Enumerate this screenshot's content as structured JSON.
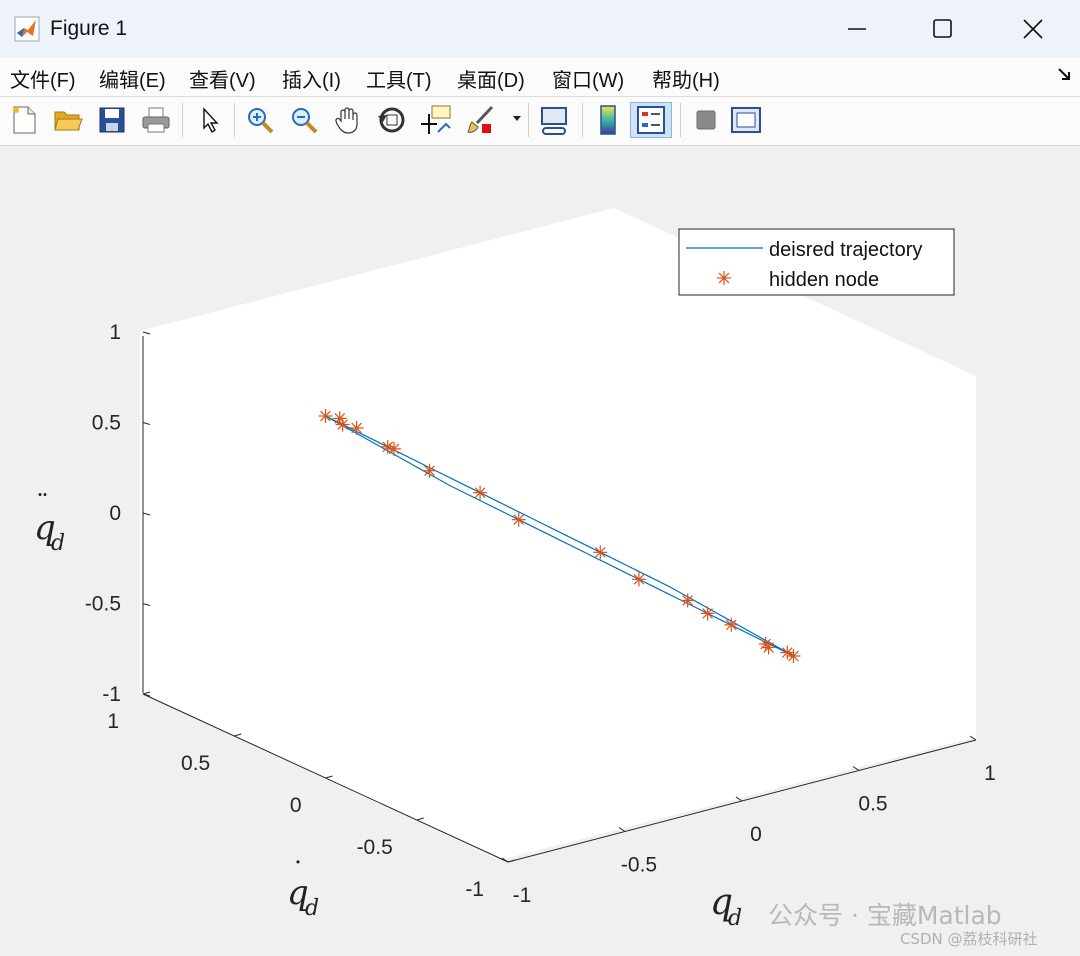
{
  "window": {
    "title": "Figure 1"
  },
  "menu": {
    "items": [
      "文件(F)",
      "编辑(E)",
      "查看(V)",
      "插入(I)",
      "工具(T)",
      "桌面(D)",
      "窗口(W)",
      "帮助(H)"
    ]
  },
  "toolbar": {
    "tools": [
      "new-figure",
      "open-file",
      "save",
      "print",
      "edit-plot",
      "zoom-in",
      "zoom-out",
      "pan",
      "rotate-3d",
      "data-cursor",
      "brush",
      "link-plot",
      "insert-colorbar",
      "insert-legend",
      "hide-plot-tools",
      "show-plot-tools"
    ]
  },
  "chart_data": {
    "type": "line",
    "projection": "3d",
    "xlabel": "q_d",
    "ylabel": "q̇_d",
    "zlabel": "q̈_d",
    "xlim": [
      -1,
      1
    ],
    "ylim": [
      -1,
      1
    ],
    "zlim": [
      -1,
      1
    ],
    "xticks": [
      "-1",
      "-0.5",
      "0",
      "0.5",
      "1"
    ],
    "yticks": [
      "-1",
      "-0.5",
      "0",
      "0.5",
      "1"
    ],
    "zticks": [
      "-1",
      "-0.5",
      "0",
      "0.5",
      "1"
    ],
    "legend": {
      "position": "top-right",
      "entries": [
        "deisred trajectory",
        "hidden  node"
      ]
    },
    "colors": {
      "trajectory": "#0072BD",
      "nodes": "#D95319"
    },
    "series": [
      {
        "name": "deisred trajectory",
        "style": "line",
        "x": [
          -1,
          -0.9,
          -0.8,
          -0.7,
          -0.6,
          -0.5,
          -0.4,
          -0.3,
          -0.2,
          -0.1,
          0,
          0.1,
          0.2,
          0.3,
          0.4,
          0.5,
          0.6,
          0.7,
          0.8,
          0.9,
          1,
          0.9,
          0.8,
          0.7,
          0.6,
          0.5,
          0.4,
          0.3,
          0.2,
          0.1,
          0,
          -0.1,
          -0.2,
          -0.3,
          -0.4,
          -0.5,
          -0.6,
          -0.7,
          -0.8,
          -0.9,
          -1
        ],
        "y": [
          0,
          0.06,
          0.12,
          0.18,
          0.24,
          0.3,
          0.36,
          0.42,
          0.48,
          0.54,
          0.6,
          0.54,
          0.48,
          0.42,
          0.36,
          0.3,
          0.24,
          0.18,
          0.12,
          0.06,
          0,
          -0.06,
          -0.12,
          -0.18,
          -0.24,
          -0.3,
          -0.36,
          -0.42,
          -0.48,
          -0.54,
          -0.6,
          -0.54,
          -0.48,
          -0.42,
          -0.36,
          -0.3,
          -0.24,
          -0.18,
          -0.12,
          -0.06,
          0
        ],
        "z": [
          1,
          0.9,
          0.8,
          0.7,
          0.6,
          0.5,
          0.4,
          0.3,
          0.2,
          0.1,
          0,
          -0.1,
          -0.2,
          -0.3,
          -0.4,
          -0.5,
          -0.6,
          -0.7,
          -0.8,
          -0.9,
          -1,
          -0.9,
          -0.8,
          -0.7,
          -0.6,
          -0.5,
          -0.4,
          -0.3,
          -0.2,
          -0.1,
          0,
          0.1,
          0.2,
          0.3,
          0.4,
          0.5,
          0.6,
          0.7,
          0.8,
          0.9,
          1
        ]
      },
      {
        "name": "hidden  node",
        "style": "marker-asterisk",
        "x": [
          -1,
          -0.9,
          -0.75,
          -0.45,
          -0.15,
          0.2,
          0.55,
          0.75,
          0.92,
          1,
          0.95,
          0.8,
          0.5,
          0.15,
          -0.2,
          -0.55,
          -0.82,
          -0.95
        ],
        "y": [
          0,
          0.05,
          0.15,
          0.33,
          0.52,
          0.48,
          0.27,
          0.15,
          0.05,
          0,
          -0.03,
          -0.12,
          -0.3,
          -0.51,
          -0.48,
          -0.27,
          -0.11,
          -0.03
        ],
        "z": [
          1,
          0.93,
          0.78,
          0.48,
          0.17,
          -0.2,
          -0.55,
          -0.75,
          -0.93,
          -1,
          -0.95,
          -0.83,
          -0.52,
          -0.17,
          0.2,
          0.55,
          0.82,
          0.95
        ]
      }
    ]
  },
  "watermark": {
    "line1": "公众号 · 宝藏Matlab",
    "line2": "CSDN @荔枝科研社"
  }
}
